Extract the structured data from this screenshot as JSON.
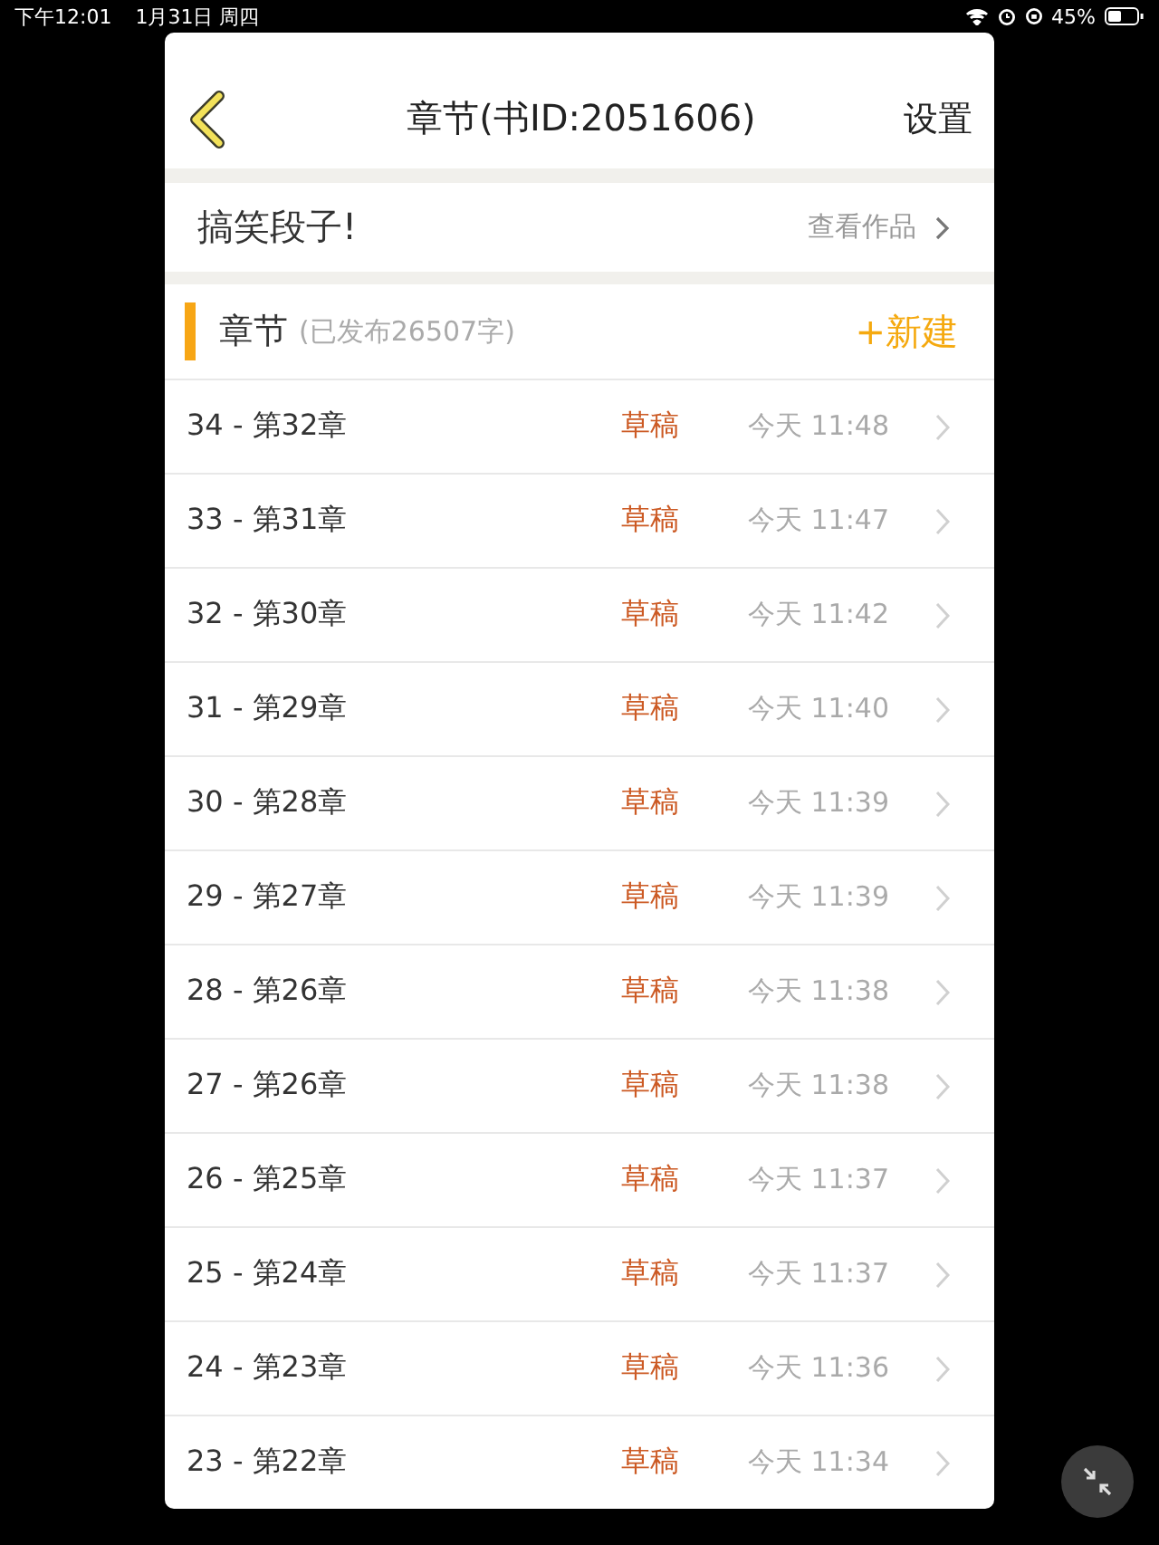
{
  "status_bar": {
    "time": "下午12:01",
    "date": "1月31日 周四",
    "battery": "45%"
  },
  "header": {
    "title": "章节(书ID:2051606)",
    "action": "设置"
  },
  "book": {
    "title": "搞笑段子!",
    "link": "查看作品"
  },
  "section": {
    "title": "章节",
    "subtitle": "(已发布26507字)",
    "action": "+新建"
  },
  "chapters": [
    {
      "name": "34 - 第32章",
      "status": "草稿",
      "time": "今天 11:48"
    },
    {
      "name": "33 - 第31章",
      "status": "草稿",
      "time": "今天 11:47"
    },
    {
      "name": "32 - 第30章",
      "status": "草稿",
      "time": "今天 11:42"
    },
    {
      "name": "31 - 第29章",
      "status": "草稿",
      "time": "今天 11:40"
    },
    {
      "name": "30 - 第28章",
      "status": "草稿",
      "time": "今天 11:39"
    },
    {
      "name": "29 - 第27章",
      "status": "草稿",
      "time": "今天 11:39"
    },
    {
      "name": "28 - 第26章",
      "status": "草稿",
      "time": "今天 11:38"
    },
    {
      "name": "27 - 第26章",
      "status": "草稿",
      "time": "今天 11:38"
    },
    {
      "name": "26 - 第25章",
      "status": "草稿",
      "time": "今天 11:37"
    },
    {
      "name": "25 - 第24章",
      "status": "草稿",
      "time": "今天 11:37"
    },
    {
      "name": "24 - 第23章",
      "status": "草稿",
      "time": "今天 11:36"
    },
    {
      "name": "23 - 第22章",
      "status": "草稿",
      "time": "今天 11:34"
    }
  ]
}
